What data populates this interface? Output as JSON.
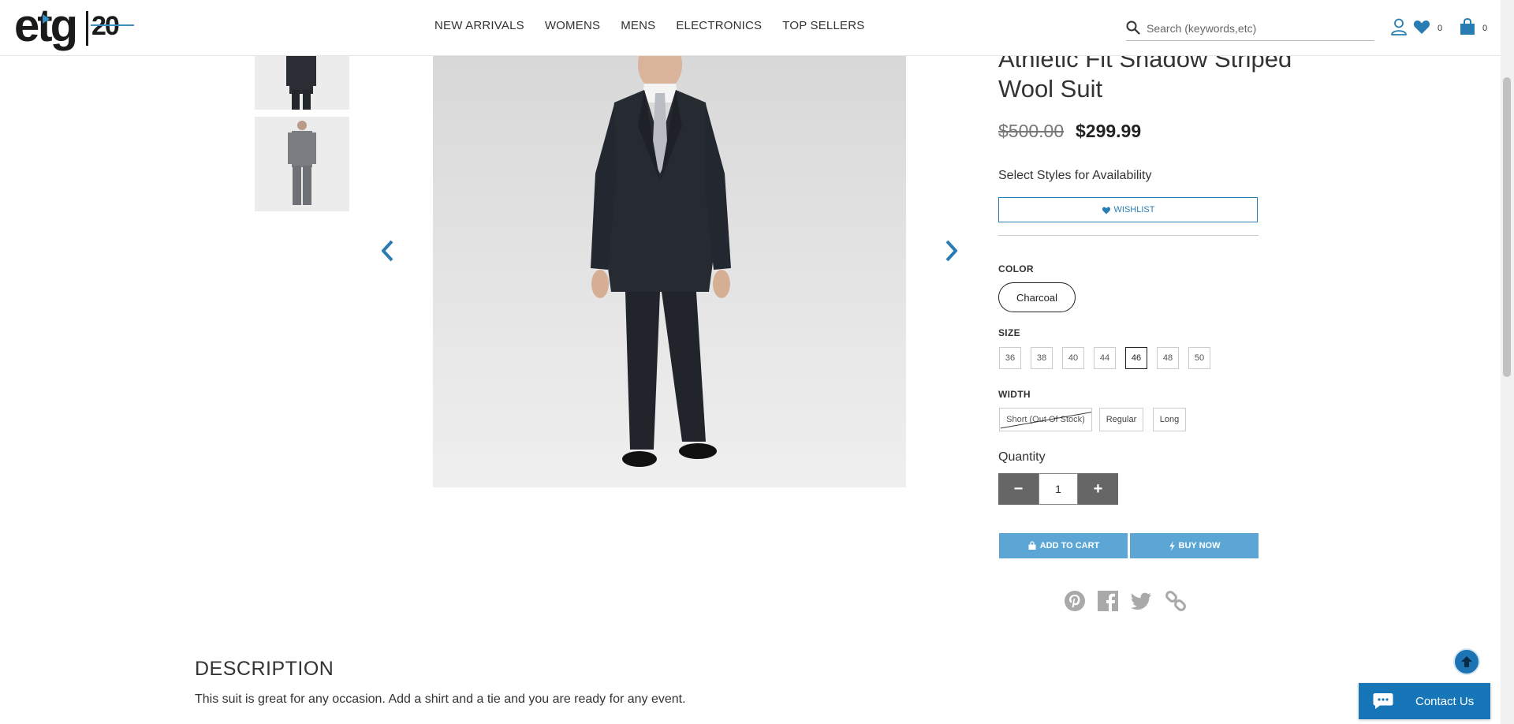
{
  "header": {
    "logo_text": "etg",
    "logo_anniversary": "20",
    "nav": [
      "NEW ARRIVALS",
      "WOMENS",
      "MENS",
      "ELECTRONICS",
      "TOP SELLERS"
    ],
    "search_placeholder": "Search (keywords,etc)",
    "wishlist_count": "0",
    "cart_count": "0"
  },
  "product": {
    "title": "Athletic Fit Shadow Striped Wool Suit",
    "old_price": "$500.00",
    "price": "$299.99",
    "availability_note": "Select Styles for Availability",
    "wishlist_label": "WISHLIST",
    "color_label": "COLOR",
    "color_selected": "Charcoal",
    "size_label": "SIZE",
    "sizes": [
      "36",
      "38",
      "40",
      "44",
      "46",
      "48",
      "50"
    ],
    "size_selected": "46",
    "width_label": "WIDTH",
    "widths": [
      "Short (Out Of Stock)",
      "Regular",
      "Long"
    ],
    "quantity_label": "Quantity",
    "quantity": "1",
    "qty_minus": "−",
    "qty_plus": "+",
    "add_to_cart_label": "ADD TO CART",
    "buy_now_label": "BUY NOW"
  },
  "share_icons": [
    "pinterest-icon",
    "facebook-icon",
    "twitter-icon",
    "link-icon"
  ],
  "description": {
    "title": "DESCRIPTION",
    "text": "This suit is great for any occasion. Add a shirt and a tie and you are ready for any event."
  },
  "contact_label": "Contact Us",
  "colors": {
    "accent": "#2a7db3",
    "button_blue": "#5ba6d4",
    "qty_grey": "#666666",
    "contact_blue": "#1776b7"
  }
}
